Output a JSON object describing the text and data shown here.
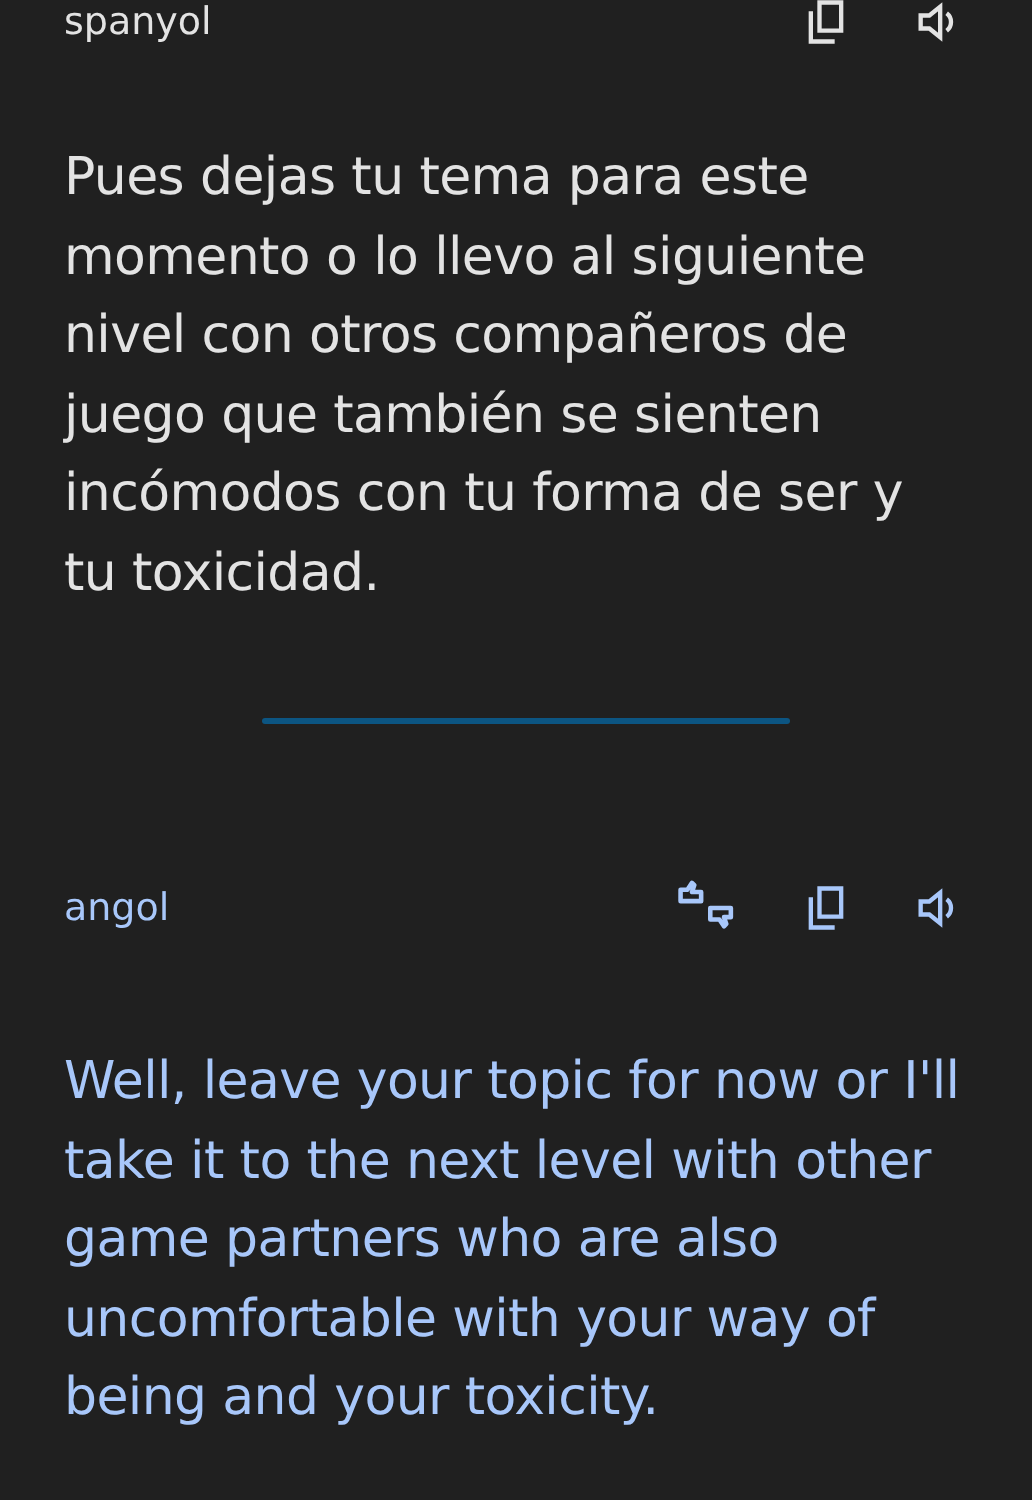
{
  "source": {
    "language": "spanyol",
    "text": "Pues dejas tu tema para este momento o lo llevo al siguiente nivel con otros compañeros de juego que también se sienten incómodos con tu forma de ser y tu toxicidad."
  },
  "target": {
    "language": "angol",
    "text": "Well, leave your topic for now or I'll take it to the next level with other game partners who are also uncomfortable with your way of being and your toxicity."
  }
}
